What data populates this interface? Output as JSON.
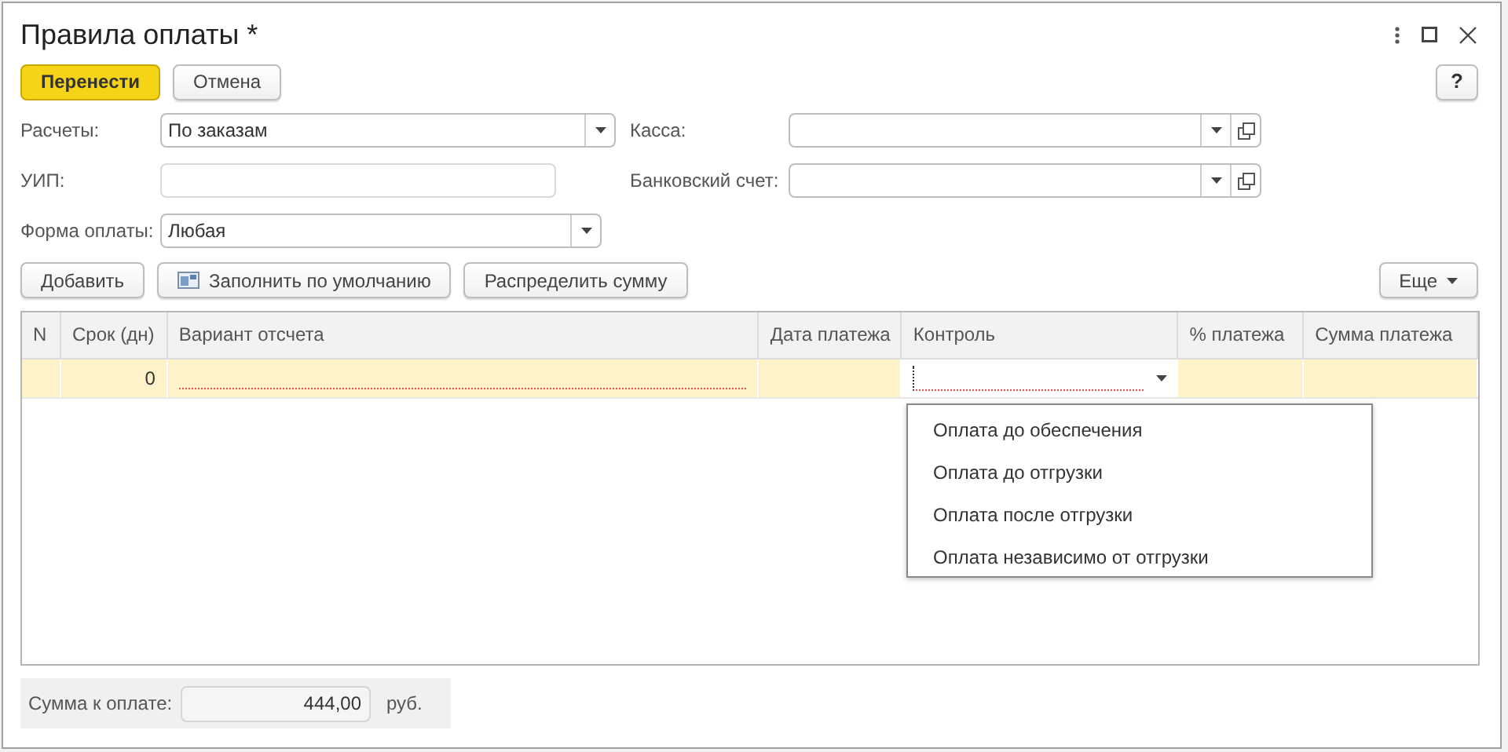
{
  "window": {
    "title": "Правила оплаты *"
  },
  "actions": [
    {
      "label": "Перенести",
      "kind": "primary"
    },
    {
      "label": "Отмена",
      "kind": "plain"
    }
  ],
  "help_button": "?",
  "left_fields": [
    {
      "label": "Расчеты:",
      "value": "По заказам",
      "kind": "select"
    },
    {
      "label": "УИП:",
      "kind": "text"
    },
    {
      "label": "Форма оплаты:",
      "value": "Любая",
      "kind": "select"
    }
  ],
  "right_fields": [
    {
      "label": "Касса:",
      "kind": "select_open"
    },
    {
      "label": "Банковский счет:",
      "kind": "select_open"
    }
  ],
  "table_buttons": [
    {
      "label": "Добавить",
      "kind": "plain"
    },
    {
      "label": "Заполнить по умолчанию",
      "kind": "fill"
    },
    {
      "label": "Распределить сумму",
      "kind": "plain"
    }
  ],
  "more_button": "Еще",
  "table": {
    "columns": [
      "N",
      "Срок (дн)",
      "Вариант отсчета",
      "Дата платежа",
      "Контроль",
      "% платежа",
      "Сумма платежа"
    ],
    "rows": [
      {
        "cells": [
          null,
          "0",
          null,
          null,
          null,
          null,
          null
        ],
        "selected": true
      }
    ]
  },
  "control_dropdown": {
    "options": [
      "Оплата до обеспечения",
      "Оплата до отгрузки",
      "Оплата после отгрузки",
      "Оплата независимо от отгрузки"
    ]
  },
  "total": {
    "label": "Сумма к оплате:",
    "value": "444,00",
    "unit": "руб."
  }
}
